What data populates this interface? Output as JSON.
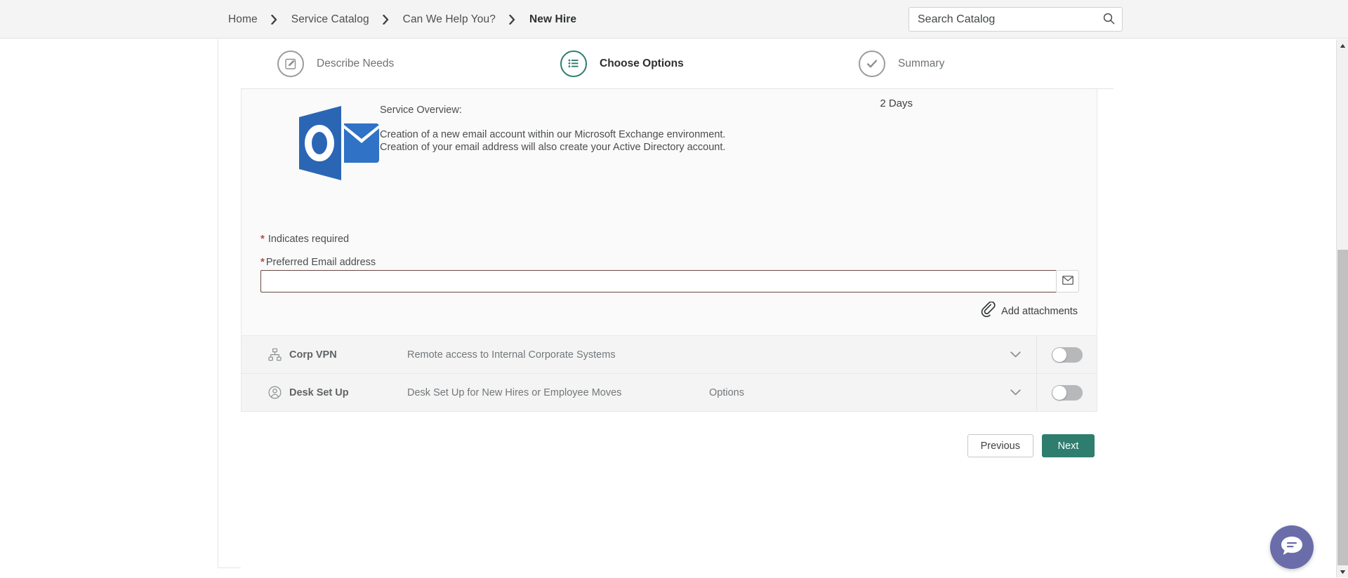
{
  "breadcrumb": {
    "items": [
      {
        "label": "Home",
        "current": false
      },
      {
        "label": "Service Catalog",
        "current": false
      },
      {
        "label": "Can We Help You?",
        "current": false
      },
      {
        "label": "New Hire",
        "current": true
      }
    ],
    "separator_icon": "chevron-right-icon"
  },
  "search": {
    "placeholder": "Search Catalog",
    "value": "",
    "icon": "search-icon"
  },
  "wizard": {
    "steps": [
      {
        "label": "Describe Needs",
        "icon": "pencil-square-icon",
        "active": false
      },
      {
        "label": "Choose Options",
        "icon": "list-icon",
        "active": true
      },
      {
        "label": "Summary",
        "icon": "check-circle-icon",
        "active": false
      }
    ],
    "active_color": "#2f7d6e",
    "inactive_color": "#9a9c9e"
  },
  "item": {
    "logo_icon": "microsoft-outlook-logo",
    "duration": "2 Days",
    "overview_title": "Service Overview:",
    "overview_body": "Creation of a new email account within our Microsoft Exchange environment. Creation of your email address will also create your Active Directory account.",
    "required_note": "Indicates required",
    "required_marker": "*",
    "field_label": "Preferred Email address",
    "field_value": "",
    "field_placeholder": "",
    "field_button_icon": "envelope-icon",
    "attachments_label": "Add attachments",
    "attachments_icon": "paperclip-icon",
    "required_color": "#b94a48",
    "input_border_color": "#6a4a45"
  },
  "options": [
    {
      "name": "Corp VPN",
      "description": "Remote access to Internal Corporate Systems",
      "extra": "",
      "icon": "sitemap-icon",
      "chevron_icon": "chevron-down-icon",
      "toggle_state": "off"
    },
    {
      "name": "Desk Set Up",
      "description": "Desk Set Up for New Hires or Employee Moves",
      "extra": "Options",
      "icon": "user-circle-icon",
      "chevron_icon": "chevron-down-icon",
      "toggle_state": "off"
    }
  ],
  "footer": {
    "previous_label": "Previous",
    "next_label": "Next",
    "next_color": "#2f7d6e"
  },
  "chat": {
    "icon": "chat-bubble-icon",
    "color": "#6a6daa"
  },
  "scrollbar": {
    "up_icon": "triangle-up-icon",
    "down_icon": "triangle-down-icon"
  }
}
